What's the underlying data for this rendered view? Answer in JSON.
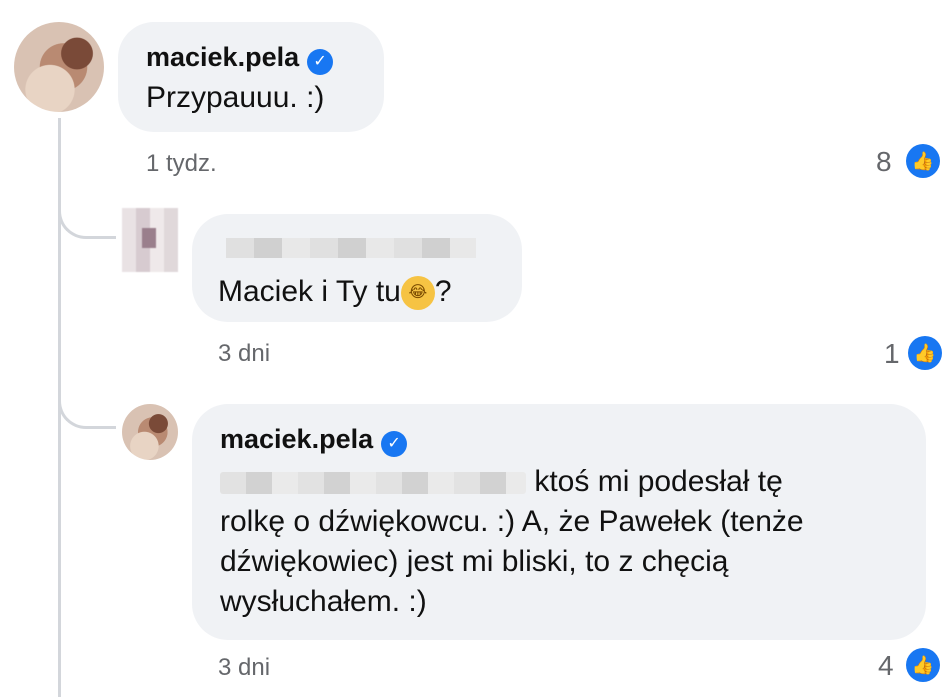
{
  "comments": [
    {
      "author": "maciek.pela",
      "verified": true,
      "text": "Przypauuu. :)",
      "time": "1 tydz.",
      "likes": "8"
    },
    {
      "author": "",
      "text_prefix": "Maciek i Ty tu",
      "text_suffix": "?",
      "emoji": "face-with-tears-of-joy-icon",
      "time": "3 dni",
      "likes": "1"
    },
    {
      "author": "maciek.pela",
      "verified": true,
      "line1": "ktoś mi podesłał tę",
      "line2": "rolkę o dźwiękowcu. :) A, że Pawełek (tenże",
      "line3": "dźwiękowiec) jest mi bliski, to z chęcią",
      "line4": "wysłuchałem. :)",
      "time": "3 dni",
      "likes": "4"
    }
  ],
  "colors": {
    "accent": "#1877f2",
    "bubble": "#f0f2f5",
    "meta": "#65676b"
  },
  "icons": {
    "verified": "verified-badge-icon",
    "like": "thumbs-up-icon"
  }
}
